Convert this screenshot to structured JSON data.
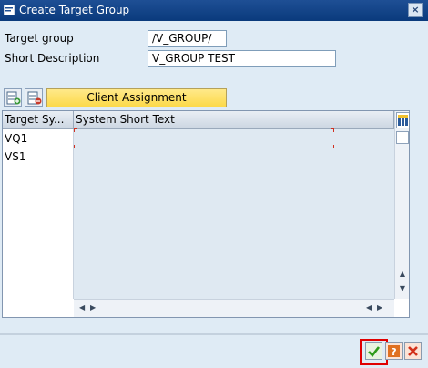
{
  "window": {
    "title": "Create Target Group",
    "close_symbol": "×"
  },
  "form": {
    "target_group_label": "Target group",
    "target_group_value": "/V_GROUP/",
    "short_desc_label": "Short Description",
    "short_desc_value": "V_GROUP TEST"
  },
  "toolbar": {
    "add_row_icon": "insert-row-icon",
    "delete_row_icon": "delete-row-icon",
    "tab_label": "Client Assignment"
  },
  "table": {
    "columns": [
      "Target Sy...",
      "System Short Text"
    ],
    "rows": [
      {
        "system": "VQ1",
        "text": ""
      },
      {
        "system": "VS1",
        "text": ""
      }
    ],
    "config_icon": "column-settings-icon"
  },
  "footer": {
    "confirm_icon": "checkmark-icon",
    "help_icon": "help-icon",
    "cancel_icon": "cancel-icon"
  },
  "colors": {
    "title_bar": "#0a3a7c",
    "tab_yellow": "#fcd949",
    "highlight_red": "#e00000"
  }
}
